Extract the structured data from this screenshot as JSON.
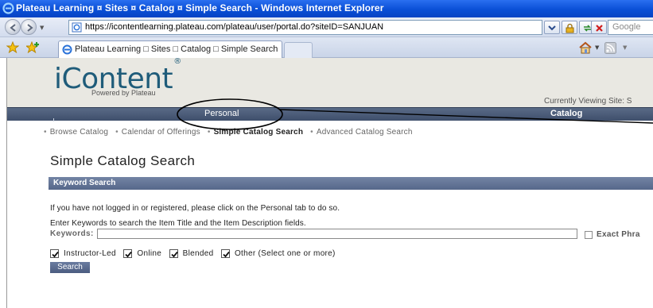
{
  "browser": {
    "title": "Plateau Learning ¤ Sites ¤ Catalog ¤ Simple Search - Windows Internet Explorer",
    "address": "https://icontentlearning.plateau.com/plateau/user/portal.do?siteID=SANJUAN",
    "search_placeholder": "Google",
    "tab_label": "Plateau Learning □ Sites □ Catalog □ Simple Search",
    "icons": {
      "back": "back-arrow-icon",
      "forward": "forward-arrow-icon",
      "lock": "lock-icon",
      "refresh": "refresh-icon",
      "stop": "stop-icon",
      "favorites": "star-icon",
      "add_favorite": "add-favorite-icon",
      "home": "home-icon",
      "feeds": "feeds-icon"
    }
  },
  "site": {
    "logo_text": "iContent",
    "logo_mark": "®",
    "powered_by": "Powered by Plateau",
    "viewing_site": "Currently Viewing Site: S"
  },
  "nav": {
    "tabs": [
      "Personal",
      "Catalog"
    ]
  },
  "subnav": {
    "items": [
      {
        "label": "Browse Catalog",
        "active": false
      },
      {
        "label": "Calendar of Offerings",
        "active": false
      },
      {
        "label": "Simple Catalog Search",
        "active": true
      },
      {
        "label": "Advanced Catalog Search",
        "active": false
      }
    ]
  },
  "main": {
    "title": "Simple Catalog Search",
    "section_title": "Keyword Search",
    "login_note": "If you have not logged in or registered, please click on the Personal tab to do so.",
    "keywords_note": "Enter Keywords to search the Item Title and the Item Description fields.",
    "keywords_label": "Keywords:",
    "keywords_value": "",
    "exact_phrase_label": "Exact Phra",
    "exact_phrase_checked": false,
    "delivery_types": [
      {
        "label": "Instructor-Led",
        "checked": true
      },
      {
        "label": "Online",
        "checked": true
      },
      {
        "label": "Blended",
        "checked": true
      },
      {
        "label": "Other (Select one or more)",
        "checked": true
      }
    ],
    "search_button": "Search"
  },
  "colors": {
    "titlebar": "#0a4fd6",
    "nav_bar": "#4a5a78",
    "logo": "#1f5c7a",
    "header_band": "#e9e8e2",
    "section_bar": "#5f7092"
  }
}
